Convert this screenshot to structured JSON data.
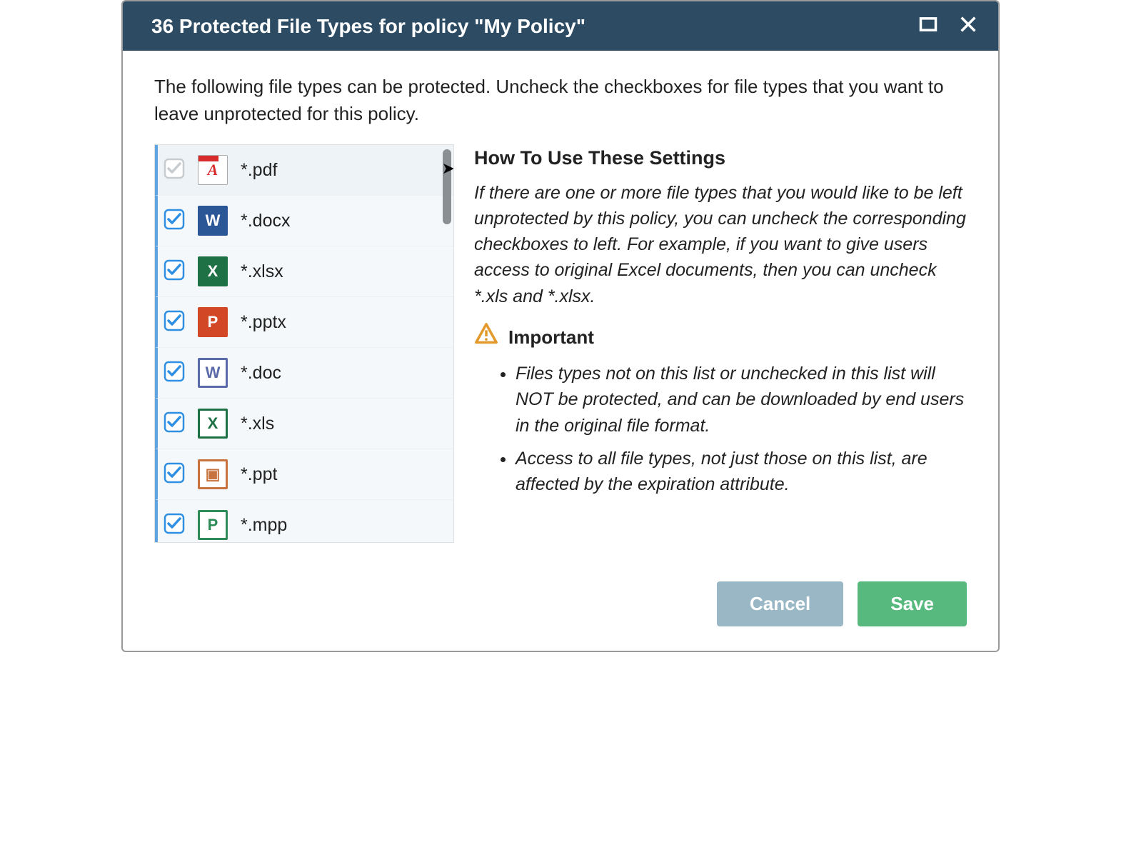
{
  "titlebar": {
    "title": "36 Protected File Types for policy \"My Policy\""
  },
  "intro": "The following file types can be protected. Uncheck the checkboxes for file types that you want to leave unprotected for this policy.",
  "file_types": [
    {
      "ext": "*.pdf",
      "icon": "pdf",
      "letter": "A",
      "checked": true,
      "disabled": true
    },
    {
      "ext": "*.docx",
      "icon": "docx",
      "letter": "W",
      "checked": true,
      "disabled": false
    },
    {
      "ext": "*.xlsx",
      "icon": "xlsx",
      "letter": "X",
      "checked": true,
      "disabled": false
    },
    {
      "ext": "*.pptx",
      "icon": "pptx",
      "letter": "P",
      "checked": true,
      "disabled": false
    },
    {
      "ext": "*.doc",
      "icon": "doc",
      "letter": "W",
      "checked": true,
      "disabled": false
    },
    {
      "ext": "*.xls",
      "icon": "xls",
      "letter": "X",
      "checked": true,
      "disabled": false
    },
    {
      "ext": "*.ppt",
      "icon": "ppt",
      "letter": "▣",
      "checked": true,
      "disabled": false
    },
    {
      "ext": "*.mpp",
      "icon": "mpp",
      "letter": "P",
      "checked": true,
      "disabled": false
    }
  ],
  "help": {
    "heading": "How To Use These Settings",
    "desc": "If there are one or more file types that you would like to be left unprotected by this policy, you can uncheck the corresponding checkboxes to left. For example, if you want to give users access to original Excel documents, then you can uncheck *.xls and *.xlsx.",
    "important_label": "Important",
    "important_items": [
      "Files types not on this list or unchecked in this list will NOT be protected, and can be downloaded by end users in the original file format.",
      "Access to all file types, not just those on this list, are affected by the expiration attribute."
    ]
  },
  "footer": {
    "cancel": "Cancel",
    "save": "Save"
  },
  "colors": {
    "checkbox_active": "#2f8fe2",
    "checkbox_disabled": "#c7ccd0"
  }
}
